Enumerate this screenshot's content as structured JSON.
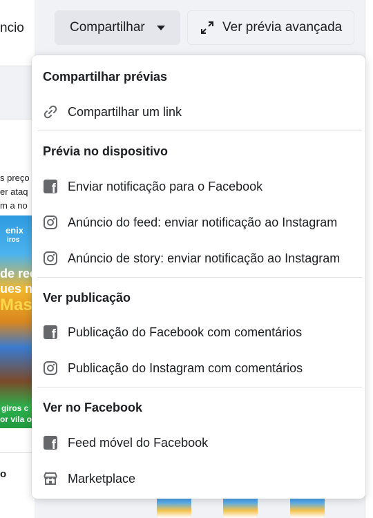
{
  "background": {
    "section_label": "ncio",
    "text_lines": [
      "s preço",
      "er ataq",
      "m a no"
    ],
    "ad_texts": [
      "enix",
      "iros",
      "de rec",
      "ues n",
      "Mas",
      "giros c",
      "or vila o"
    ],
    "side_label": "o"
  },
  "header": {
    "share_label": "Compartilhar",
    "advanced_preview_label": "Ver prévia avançada"
  },
  "menu": {
    "sections": [
      {
        "title": "Compartilhar prévias",
        "items": [
          {
            "label": "Compartilhar um link",
            "icon": "link-icon"
          }
        ]
      },
      {
        "title": "Prévia no dispositivo",
        "items": [
          {
            "label": "Enviar notificação para o Facebook",
            "icon": "facebook-icon"
          },
          {
            "label": "Anúncio do feed: enviar notificação ao Instagram",
            "icon": "instagram-icon"
          },
          {
            "label": "Anúncio de story: enviar notificação ao Instagram",
            "icon": "instagram-icon"
          }
        ]
      },
      {
        "title": "Ver publicação",
        "items": [
          {
            "label": "Publicação do Facebook com comentários",
            "icon": "facebook-icon"
          },
          {
            "label": "Publicação do Instagram com comentários",
            "icon": "instagram-icon"
          }
        ]
      },
      {
        "title": "Ver no Facebook",
        "items": [
          {
            "label": "Feed móvel do Facebook",
            "icon": "facebook-icon"
          },
          {
            "label": "Marketplace",
            "icon": "marketplace-icon"
          }
        ]
      }
    ]
  },
  "colors": {
    "icon_gray": "#65676b",
    "button_bg": "#e4e6eb",
    "page_bg": "#f0f2f5"
  }
}
